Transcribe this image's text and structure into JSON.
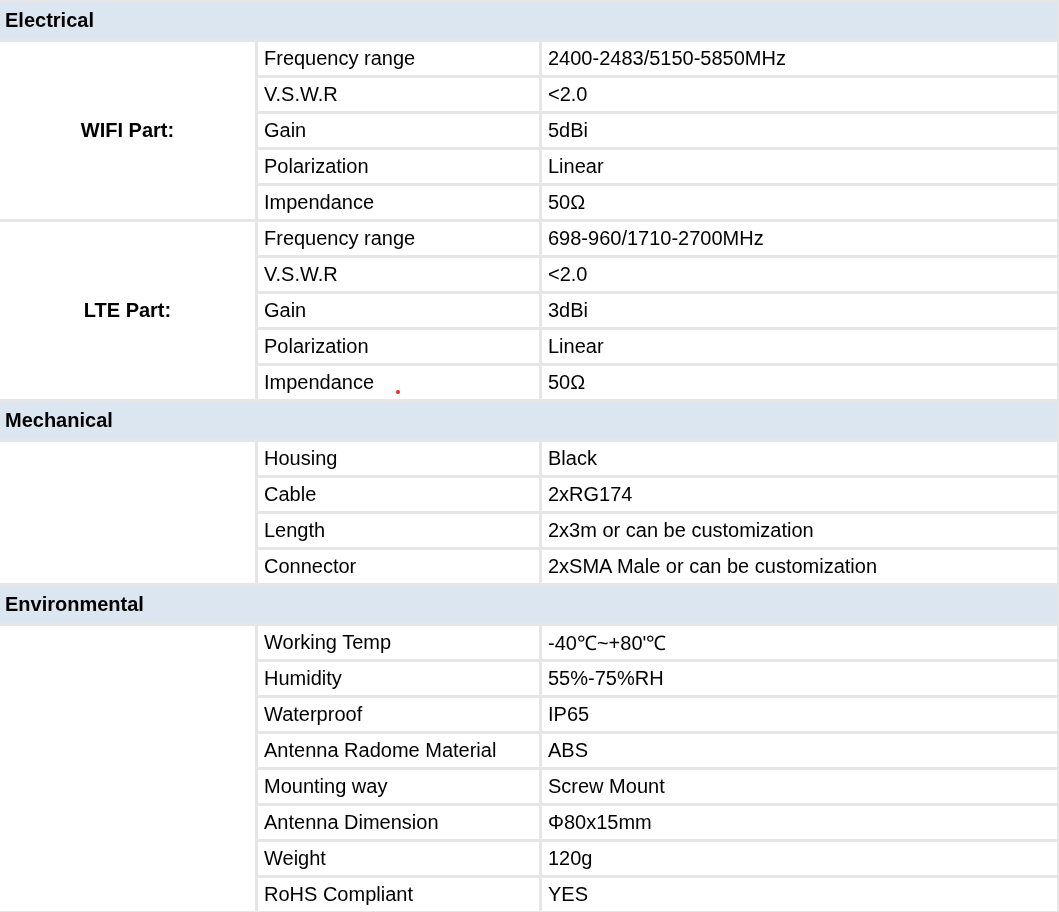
{
  "sections": [
    {
      "title": "Electrical",
      "groups": [
        {
          "label": "WIFI Part:",
          "rows": [
            {
              "parameter": "Frequency range",
              "value": "2400-2483/5150-5850MHz"
            },
            {
              "parameter": "V.S.W.R",
              "value": "<2.0"
            },
            {
              "parameter": "Gain",
              "value": "5dBi"
            },
            {
              "parameter": "Polarization",
              "value": "Linear"
            },
            {
              "parameter": "Impendance",
              "value": "50Ω"
            }
          ]
        },
        {
          "label": "LTE Part:",
          "rows": [
            {
              "parameter": "Frequency range",
              "value": "698-960/1710-2700MHz"
            },
            {
              "parameter": "V.S.W.R",
              "value": "<2.0"
            },
            {
              "parameter": "Gain",
              "value": "3dBi"
            },
            {
              "parameter": "Polarization",
              "value": "Linear"
            },
            {
              "parameter": "Impendance",
              "value": "50Ω",
              "stray_mark": true
            }
          ]
        }
      ]
    },
    {
      "title": "Mechanical",
      "groups": [
        {
          "rows": [
            {
              "parameter": "Housing",
              "value": "Black"
            },
            {
              "parameter": "Cable",
              "value": "2xRG174"
            },
            {
              "parameter": "Length",
              "value": "2x3m or can be customization"
            },
            {
              "parameter": "Connector",
              "value": "2xSMA Male or can be customization"
            }
          ]
        }
      ]
    },
    {
      "title": "Environmental",
      "groups": [
        {
          "rows": [
            {
              "parameter": "Working Temp",
              "value": "-40℃~+80'℃"
            },
            {
              "parameter": "Humidity",
              "value": "55%-75%RH"
            },
            {
              "parameter": "Waterproof",
              "value": "IP65"
            },
            {
              "parameter": "Antenna Radome Material",
              "value": "ABS"
            },
            {
              "parameter": "Mounting way",
              "value": "Screw Mount"
            },
            {
              "parameter": "Antenna Dimension",
              "value": "Φ80x15mm"
            },
            {
              "parameter": "Weight",
              "value": "120g"
            },
            {
              "parameter": "RoHS Compliant",
              "value": "YES"
            }
          ]
        }
      ]
    }
  ]
}
